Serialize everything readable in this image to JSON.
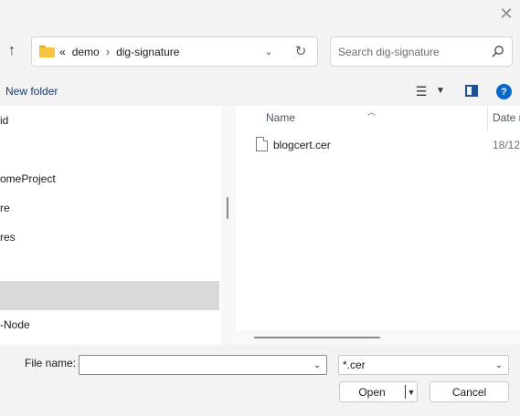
{
  "address": {
    "overflow": "«",
    "crumbs": [
      "demo",
      "dig-signature"
    ],
    "separator": "›"
  },
  "search": {
    "placeholder": "Search dig-signature"
  },
  "toolbar": {
    "new_folder": "New folder",
    "help": "?"
  },
  "nav": {
    "items": [
      {
        "label": "id",
        "selected": false
      },
      {
        "label": "omeProject",
        "selected": false
      },
      {
        "label": "re",
        "selected": false
      },
      {
        "label": "res",
        "selected": false
      },
      {
        "label": "",
        "selected": true
      },
      {
        "label": "-Node",
        "selected": false
      }
    ]
  },
  "files": {
    "columns": {
      "name": "Name",
      "date": "Date m"
    },
    "rows": [
      {
        "name": "blogcert.cer",
        "date": "18/12,"
      }
    ]
  },
  "footer": {
    "file_name_label": "File name:",
    "file_name_value": "",
    "file_type": "*.cer",
    "open_label": "Open",
    "cancel_label": "Cancel"
  }
}
